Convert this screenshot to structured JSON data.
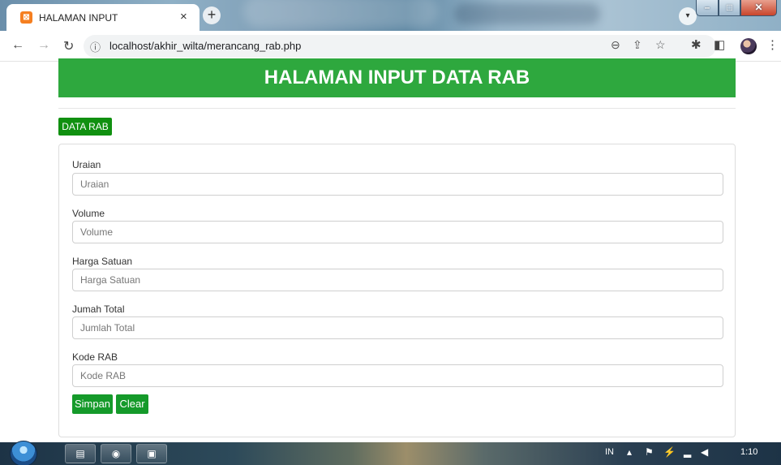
{
  "browser": {
    "tab_title": "HALAMAN INPUT",
    "tab_close": "×",
    "new_tab": "+",
    "url": "localhost/akhir_wilta/merancang_rab.php",
    "info_icon": "ⓘ"
  },
  "page": {
    "header": "HALAMAN INPUT DATA RAB",
    "data_rab_button": "DATA RAB"
  },
  "form": {
    "fields": [
      {
        "label": "Uraian",
        "placeholder": "Uraian"
      },
      {
        "label": "Volume",
        "placeholder": "Volume"
      },
      {
        "label": "Harga Satuan",
        "placeholder": "Harga Satuan"
      },
      {
        "label": "Jumah Total",
        "placeholder": "Jumlah Total"
      },
      {
        "label": "Kode RAB",
        "placeholder": "Kode RAB"
      }
    ],
    "save_label": "Simpan",
    "clear_label": "Clear"
  },
  "taskbar": {
    "language": "IN",
    "clock": "1:10"
  },
  "colors": {
    "header_green": "#2ea83e",
    "button_green": "#159a2a",
    "data_rab_green": "#109010"
  }
}
